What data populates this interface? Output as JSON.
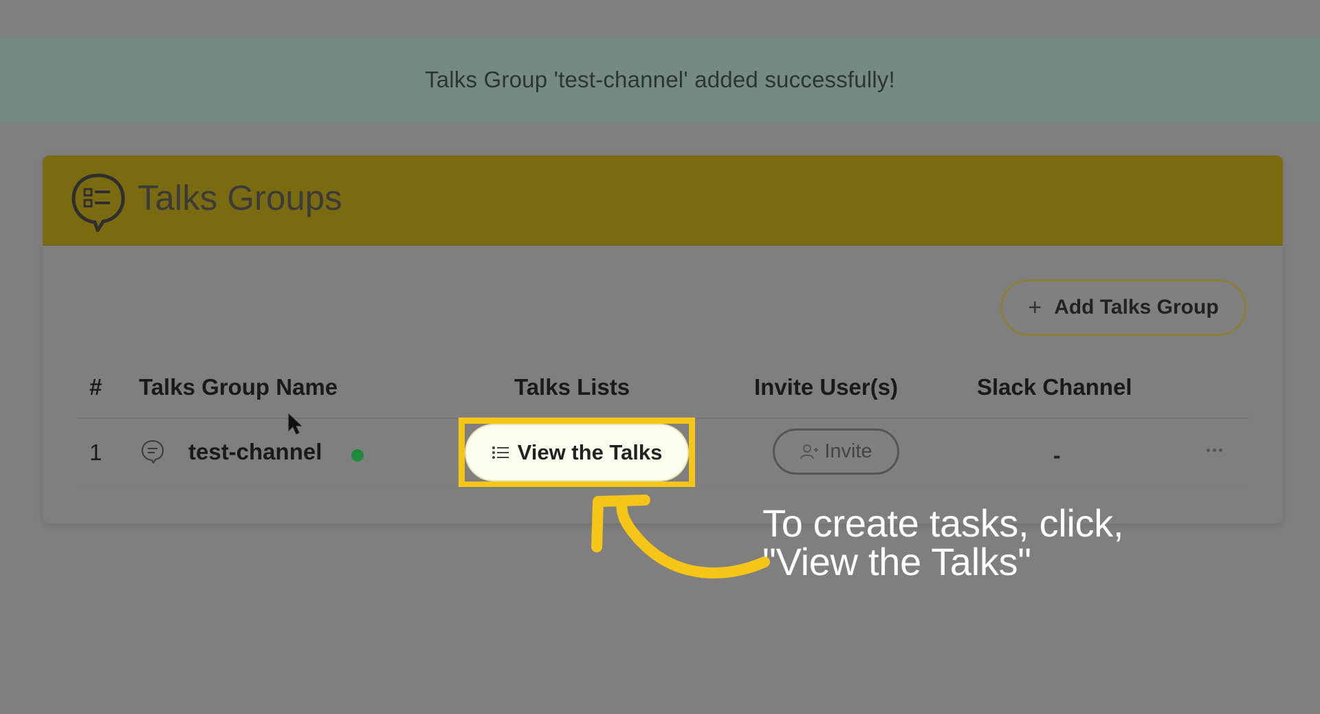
{
  "banner": {
    "message": "Talks Group 'test-channel' added successfully!"
  },
  "card": {
    "title": "Talks Groups",
    "icon": "chat-list-icon",
    "add_button_label": "Add Talks Group"
  },
  "table": {
    "headers": [
      "#",
      "Talks Group Name",
      "Talks Lists",
      "Invite User(s)",
      "Slack Channel"
    ],
    "rows": [
      {
        "index": "1",
        "name": "test-channel",
        "status": "online",
        "talks_button_label": "View the Talks",
        "invite_button_label": "Invite",
        "slack_channel": "-"
      }
    ]
  },
  "annotation": {
    "line1": "To create tasks, click,",
    "line2": "\"View the Talks\""
  },
  "colors": {
    "highlight": "#f5c518",
    "header_band": "#7a6b10",
    "banner": "#778a82",
    "status_dot": "#1e8a3a"
  }
}
